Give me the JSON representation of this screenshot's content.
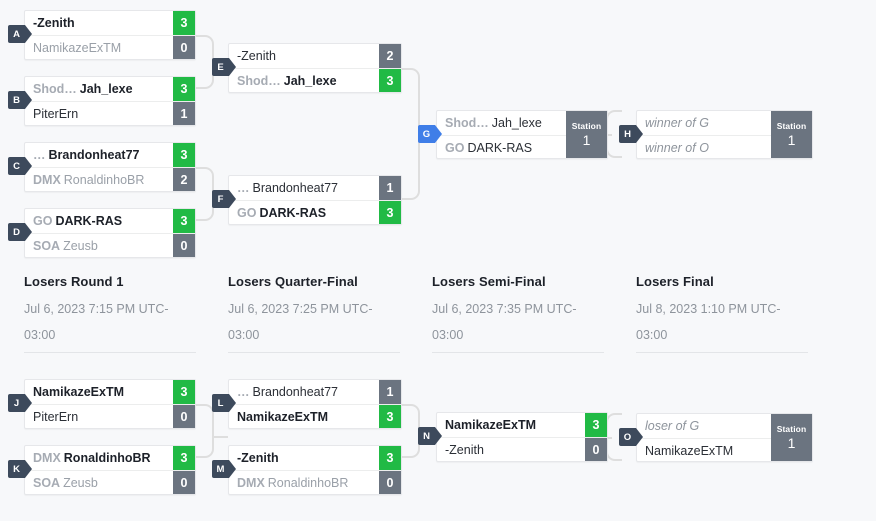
{
  "theme": {
    "background": "#f7f8fa",
    "card_bg": "#ffffff",
    "card_border": "#e6e7ea",
    "connector": "#dedede",
    "score_winner": "#21ba45",
    "score_loser": "#6b7480",
    "badge": "#3d4a5c",
    "badge_active": "#3f7ee8",
    "station_bg": "#6b7480",
    "text_primary": "#1d2129",
    "text_muted": "#9aa0a8"
  },
  "station": {
    "label": "Station",
    "number": "1"
  },
  "rounds": [
    {
      "title": "Losers Round 1",
      "date_line_1": "Jul 6, 2023 7:15 PM UTC-",
      "date_line_2": "03:00"
    },
    {
      "title": "Losers Quarter-Final",
      "date_line_1": "Jul 6, 2023 7:25 PM UTC-",
      "date_line_2": "03:00"
    },
    {
      "title": "Losers Semi-Final",
      "date_line_1": "Jul 6, 2023 7:35 PM UTC-",
      "date_line_2": "03:00"
    },
    {
      "title": "Losers Final",
      "date_line_1": "Jul 8, 2023 1:10 PM UTC-",
      "date_line_2": "03:00"
    }
  ],
  "matches": {
    "A": {
      "letter": "A",
      "top": {
        "tag": "",
        "name": "-Zenith",
        "score": "3"
      },
      "bottom": {
        "tag": "",
        "name": "NamikazeExTM",
        "score": "0"
      }
    },
    "B": {
      "letter": "B",
      "top": {
        "tag": "Shod…",
        "name": "Jah_lexe",
        "score": "3"
      },
      "bottom": {
        "tag": "",
        "name": "PiterErn",
        "score": "1"
      }
    },
    "C": {
      "letter": "C",
      "top": {
        "tag": "…",
        "name": "Brandonheat77",
        "score": "3"
      },
      "bottom": {
        "tag": "DMX",
        "name": "RonaldinhoBR",
        "score": "2"
      }
    },
    "D": {
      "letter": "D",
      "top": {
        "tag": "GO",
        "name": "DARK-RAS",
        "score": "3"
      },
      "bottom": {
        "tag": "SOA",
        "name": "Zeusb",
        "score": "0"
      }
    },
    "E": {
      "letter": "E",
      "top": {
        "tag": "",
        "name": "-Zenith",
        "score": "2"
      },
      "bottom": {
        "tag": "Shod…",
        "name": "Jah_lexe",
        "score": "3"
      }
    },
    "F": {
      "letter": "F",
      "top": {
        "tag": "…",
        "name": "Brandonheat77",
        "score": "1"
      },
      "bottom": {
        "tag": "GO",
        "name": "DARK-RAS",
        "score": "3"
      }
    },
    "G": {
      "letter": "G",
      "top": {
        "tag": "Shod…",
        "name": "Jah_lexe"
      },
      "bottom": {
        "tag": "GO",
        "name": "DARK-RAS"
      }
    },
    "H": {
      "letter": "H",
      "top": {
        "tag": "",
        "name": "winner of G"
      },
      "bottom": {
        "tag": "",
        "name": "winner of O"
      }
    },
    "J": {
      "letter": "J",
      "top": {
        "tag": "",
        "name": "NamikazeExTM",
        "score": "3"
      },
      "bottom": {
        "tag": "",
        "name": "PiterErn",
        "score": "0"
      }
    },
    "K": {
      "letter": "K",
      "top": {
        "tag": "DMX",
        "name": "RonaldinhoBR",
        "score": "3"
      },
      "bottom": {
        "tag": "SOA",
        "name": "Zeusb",
        "score": "0"
      }
    },
    "L": {
      "letter": "L",
      "top": {
        "tag": "…",
        "name": "Brandonheat77",
        "score": "1"
      },
      "bottom": {
        "tag": "",
        "name": "NamikazeExTM",
        "score": "3"
      }
    },
    "M": {
      "letter": "M",
      "top": {
        "tag": "",
        "name": "-Zenith",
        "score": "3"
      },
      "bottom": {
        "tag": "DMX",
        "name": "RonaldinhoBR",
        "score": "0"
      }
    },
    "N": {
      "letter": "N",
      "top": {
        "tag": "",
        "name": "NamikazeExTM",
        "score": "3"
      },
      "bottom": {
        "tag": "",
        "name": "-Zenith",
        "score": "0"
      }
    },
    "O": {
      "letter": "O",
      "top": {
        "tag": "",
        "name": "loser of G"
      },
      "bottom": {
        "tag": "",
        "name": "NamikazeExTM"
      }
    }
  }
}
